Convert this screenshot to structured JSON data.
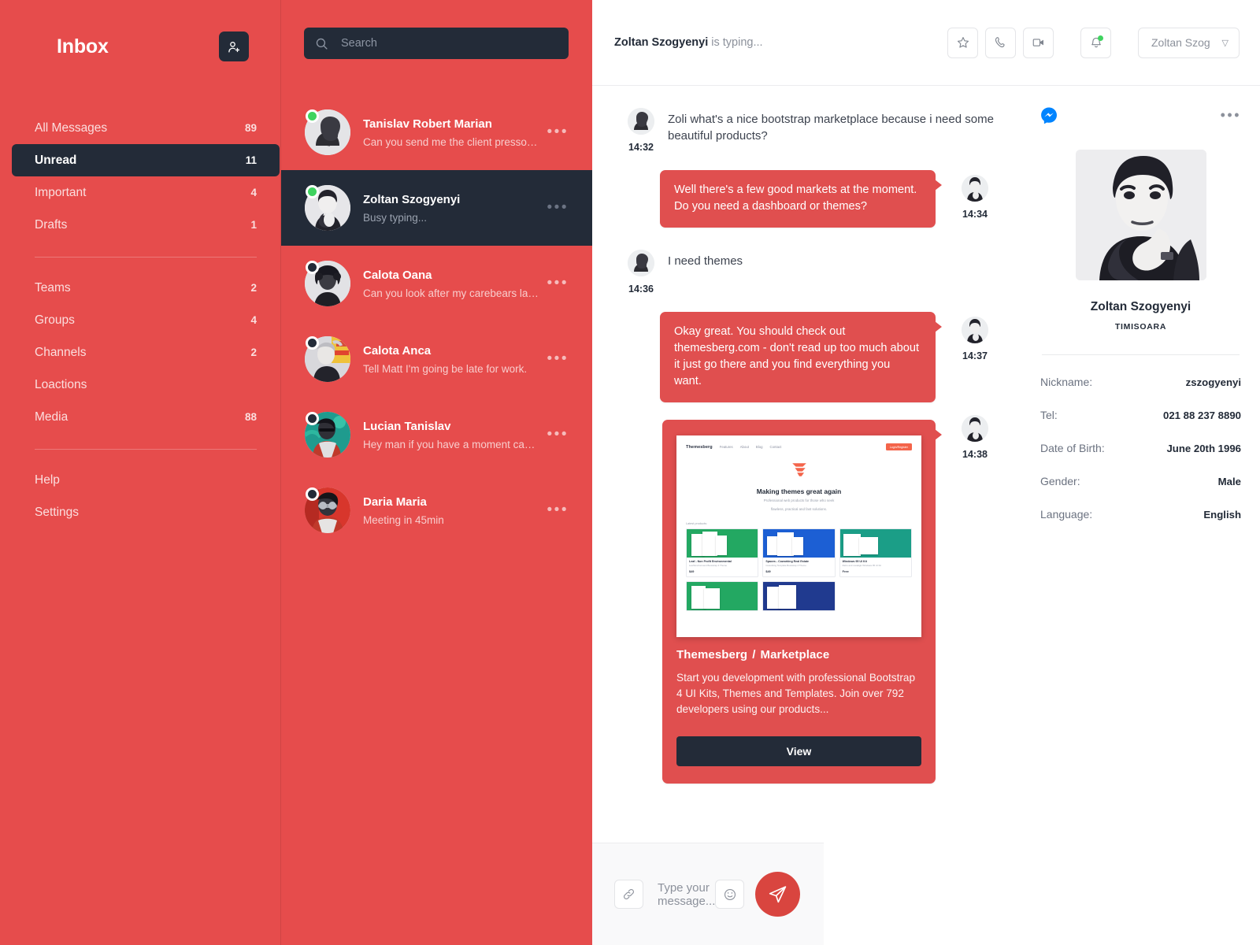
{
  "sidebar": {
    "title": "Inbox",
    "add_user_icon": "add-user-icon",
    "groups": [
      [
        {
          "label": "All Messages",
          "count": "89",
          "active": false
        },
        {
          "label": "Unread",
          "count": "11",
          "active": true
        },
        {
          "label": "Important",
          "count": "4",
          "active": false
        },
        {
          "label": "Drafts",
          "count": "1",
          "active": false
        }
      ],
      [
        {
          "label": "Teams",
          "count": "2",
          "active": false
        },
        {
          "label": "Groups",
          "count": "4",
          "active": false
        },
        {
          "label": "Channels",
          "count": "2",
          "active": false
        },
        {
          "label": "Loactions",
          "count": "",
          "active": false
        },
        {
          "label": "Media",
          "count": "88",
          "active": false
        }
      ],
      [
        {
          "label": "Help",
          "count": "",
          "active": false
        },
        {
          "label": "Settings",
          "count": "",
          "active": false
        }
      ]
    ]
  },
  "search": {
    "placeholder": "Search",
    "icon": "search-icon"
  },
  "conversations": [
    {
      "name": "Tanislav Robert Marian",
      "preview": "Can you send me the client presso ....",
      "status": "online",
      "selected": false
    },
    {
      "name": "Zoltan Szogyenyi",
      "preview": "Busy typing...",
      "status": "online",
      "selected": true
    },
    {
      "name": "Calota Oana",
      "preview": "Can you look after my carebears later?",
      "status": "offline",
      "selected": false
    },
    {
      "name": "Calota Anca",
      "preview": "Tell Matt I'm going be late for work.",
      "status": "offline",
      "selected": false
    },
    {
      "name": "Lucian Tanislav",
      "preview": "Hey man if you have a moment can you ...",
      "status": "offline",
      "selected": false
    },
    {
      "name": "Daria Maria",
      "preview": "Meeting in 45min",
      "status": "offline",
      "selected": false
    }
  ],
  "chat_header": {
    "typing_name": "Zoltan Szogyenyi",
    "typing_suffix": " is typing...",
    "actions": [
      "star-icon",
      "phone-icon",
      "video-camera-icon",
      "bell-icon"
    ],
    "user_select_label": "Zoltan Szog",
    "caret": "▽"
  },
  "messages": [
    {
      "dir": "in",
      "time": "14:32",
      "text": "Zoli what's a nice bootstrap marketplace because i need some beautiful products?"
    },
    {
      "dir": "out",
      "time": "14:34",
      "text": "Well there's a few good markets at the moment. Do you need a dashboard or themes?"
    },
    {
      "dir": "in",
      "time": "14:36",
      "text": "I need themes"
    },
    {
      "dir": "out",
      "time": "14:37",
      "text": "Okay great. You should check out themesberg.com - don't read up too much about it just go there and you find everything you want."
    }
  ],
  "link_card": {
    "time": "14:38",
    "title_left": "Themesberg",
    "title_sep": "/",
    "title_right": "Marketplace",
    "description": "Start you development with professional Bootstrap 4 UI Kits, Themes and Templates. Join over 792 developers using our products...",
    "button_label": "View",
    "preview_site": {
      "logo": "Themesberg",
      "nav": [
        "Features",
        "About",
        "Blog",
        "Contact"
      ],
      "cta": "Login/Register",
      "headline": "Making themes great again",
      "subhead_line1": "Professional web products for those who seek",
      "subhead_line2": "flawless, practical and fast solutions.",
      "section_label": "Latest products:",
      "products": [
        {
          "title": "Leaf - Non Profit Environmental",
          "desc": "Leaf Environment Bootstrap 4 Theme",
          "price": "$49",
          "color": "#23a862"
        },
        {
          "title": "Spaces - Coworking Real Estate",
          "desc": "Coworking Template Bootstrap 4 Theme",
          "price": "$49",
          "color": "#1c5fd4"
        },
        {
          "title": "Windows 95 UI Kit",
          "desc": "Retro and nostalgic Windows 95 UI Kit",
          "price": "Free",
          "color": "#1b9e87"
        },
        {
          "title": "",
          "desc": "",
          "price": "",
          "color": "#23a862"
        },
        {
          "title": "",
          "desc": "",
          "price": "",
          "color": "#203a8f"
        }
      ]
    }
  },
  "profile": {
    "messenger_icon": "messenger-icon",
    "more_icon": "more-horizontal-icon",
    "name": "Zoltan Szogyenyi",
    "city": "TIMISOARA",
    "fields": [
      {
        "key": "Nickname:",
        "value": "zszogyenyi"
      },
      {
        "key": "Tel:",
        "value": "021 88 237 8890"
      },
      {
        "key": "Date of Birth:",
        "value": "June 20th 1996"
      },
      {
        "key": "Gender:",
        "value": "Male"
      },
      {
        "key": "Language:",
        "value": "English"
      }
    ]
  },
  "composer": {
    "attach_icon": "link-icon",
    "placeholder": "Type your message...",
    "emoji_icon": "smiley-icon",
    "send_icon": "send-icon"
  },
  "colors": {
    "brand_red": "#e64c4c",
    "bubble_red": "#e04f4f",
    "dark_navy": "#232b38",
    "online_green": "#3fd35f",
    "messenger_blue": "#0084ff",
    "send_red": "#d9453f"
  }
}
